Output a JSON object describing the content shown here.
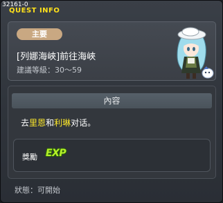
{
  "window": {
    "quest_id": "32161-0",
    "title": "QUEST INFO"
  },
  "quest": {
    "category": "主要",
    "name": "[列娜海峽]前往海峽",
    "level_label": "建議等級",
    "level_range": "30～59"
  },
  "content": {
    "header": "內容",
    "text_prefix": "去",
    "npc_1": "里恩",
    "connector": "和",
    "npc_2": "利琳",
    "text_suffix": "对话。"
  },
  "reward": {
    "label": "獎勵",
    "exp_text": "EXP"
  },
  "status": {
    "label": "狀態",
    "value": "可開始"
  },
  "icons": {
    "npc_portrait": "npc-portrait-icon",
    "exp": "exp-icon"
  },
  "colors": {
    "title": "#ffe11a",
    "npc_highlight": "#ffea2a",
    "badge": "#c9a882",
    "exp": "#b6f02a"
  }
}
